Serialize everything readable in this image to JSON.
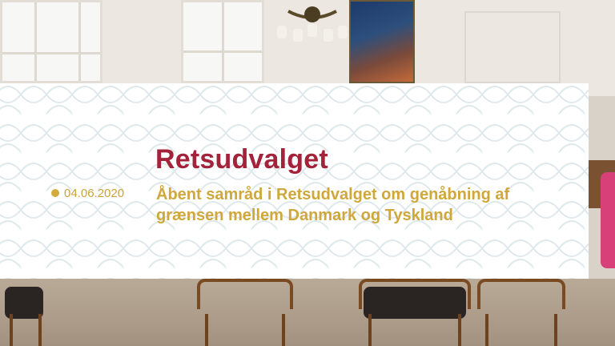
{
  "banner": {
    "committee": "Retsudvalget",
    "date": "04.06.2020",
    "subtitle_line1": "Åbent samråd i Retsudvalget om genåbning af",
    "subtitle_line2": "grænsen mellem Danmark og Tyskland"
  },
  "colors": {
    "committee_red": "#a3233a",
    "accent_gold": "#cfa73a",
    "pattern_line": "#dfe9ec"
  },
  "icons": {
    "bullet": "gold-dot-icon"
  }
}
